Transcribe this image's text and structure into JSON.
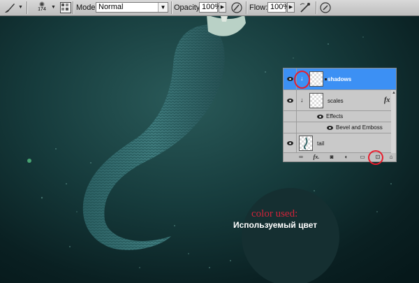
{
  "options_bar": {
    "tool_icon": "brush-tool-icon",
    "brush_size": "174",
    "mode_label": "Mode:",
    "mode_value": "Normal",
    "opacity_label": "Opacity:",
    "opacity_value": "100%",
    "flow_label": "Flow:",
    "flow_value": "100%",
    "airbrush_icon": "airbrush-icon",
    "pressure_icon": "tablet-pressure-icon"
  },
  "canvas": {
    "annotation_en": "color used:",
    "annotation_ru": "Используемый цвет",
    "swatch_color": "#152f31",
    "annotation_color": "#d0243a"
  },
  "layers_panel": {
    "layers": [
      {
        "name": "shadows",
        "selected": true,
        "visible": true,
        "clipped": true
      },
      {
        "name": "scales",
        "selected": false,
        "visible": true,
        "clipped": true,
        "fx": "fx"
      },
      {
        "name": "tail",
        "selected": false,
        "visible": true
      }
    ],
    "effects_label": "Effects",
    "effect_name": "Bevel and Emboss",
    "selection_color": "#3c90f4",
    "footer_icons": [
      "link-icon",
      "fx-icon",
      "mask-icon",
      "adjustment-icon",
      "folder-icon",
      "new-layer-icon",
      "trash-icon"
    ]
  }
}
